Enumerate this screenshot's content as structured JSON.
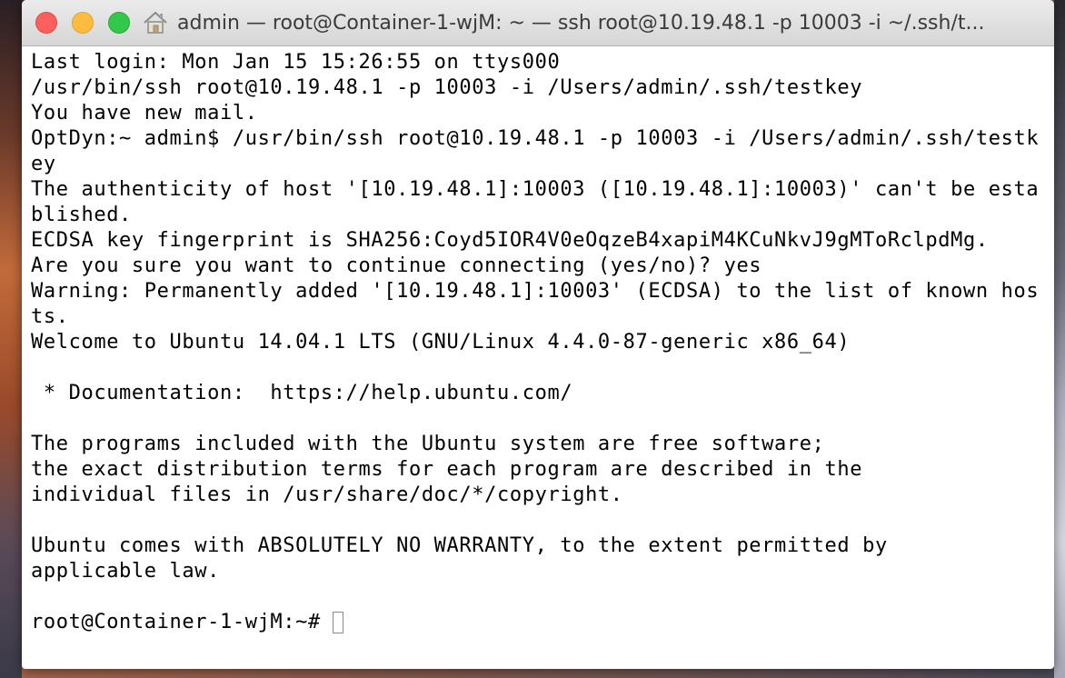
{
  "window": {
    "title": "admin — root@Container-1-wjM: ~ — ssh root@10.19.48.1 -p 10003 -i ~/.ssh/t..."
  },
  "icons": {
    "close": "close-button",
    "minimize": "minimize-button",
    "zoom": "zoom-button",
    "home": "home-icon"
  },
  "colors": {
    "close": "#fc605c",
    "minimize": "#fdbc40",
    "zoom": "#34c84a"
  },
  "terminal": {
    "lines": [
      "Last login: Mon Jan 15 15:26:55 on ttys000",
      "/usr/bin/ssh root@10.19.48.1 -p 10003 -i /Users/admin/.ssh/testkey",
      "You have new mail.",
      "OptDyn:~ admin$ /usr/bin/ssh root@10.19.48.1 -p 10003 -i /Users/admin/.ssh/testk",
      "ey",
      "The authenticity of host '[10.19.48.1]:10003 ([10.19.48.1]:10003)' can't be esta",
      "blished.",
      "ECDSA key fingerprint is SHA256:Coyd5IOR4V0eOqzeB4xapiM4KCuNkvJ9gMToRclpdMg.",
      "Are you sure you want to continue connecting (yes/no)? yes",
      "Warning: Permanently added '[10.19.48.1]:10003' (ECDSA) to the list of known hos",
      "ts.",
      "Welcome to Ubuntu 14.04.1 LTS (GNU/Linux 4.4.0-87-generic x86_64)",
      "",
      " * Documentation:  https://help.ubuntu.com/",
      "",
      "The programs included with the Ubuntu system are free software;",
      "the exact distribution terms for each program are described in the",
      "individual files in /usr/share/doc/*/copyright.",
      "",
      "Ubuntu comes with ABSOLUTELY NO WARRANTY, to the extent permitted by",
      "applicable law.",
      ""
    ],
    "prompt": "root@Container-1-wjM:~#"
  }
}
